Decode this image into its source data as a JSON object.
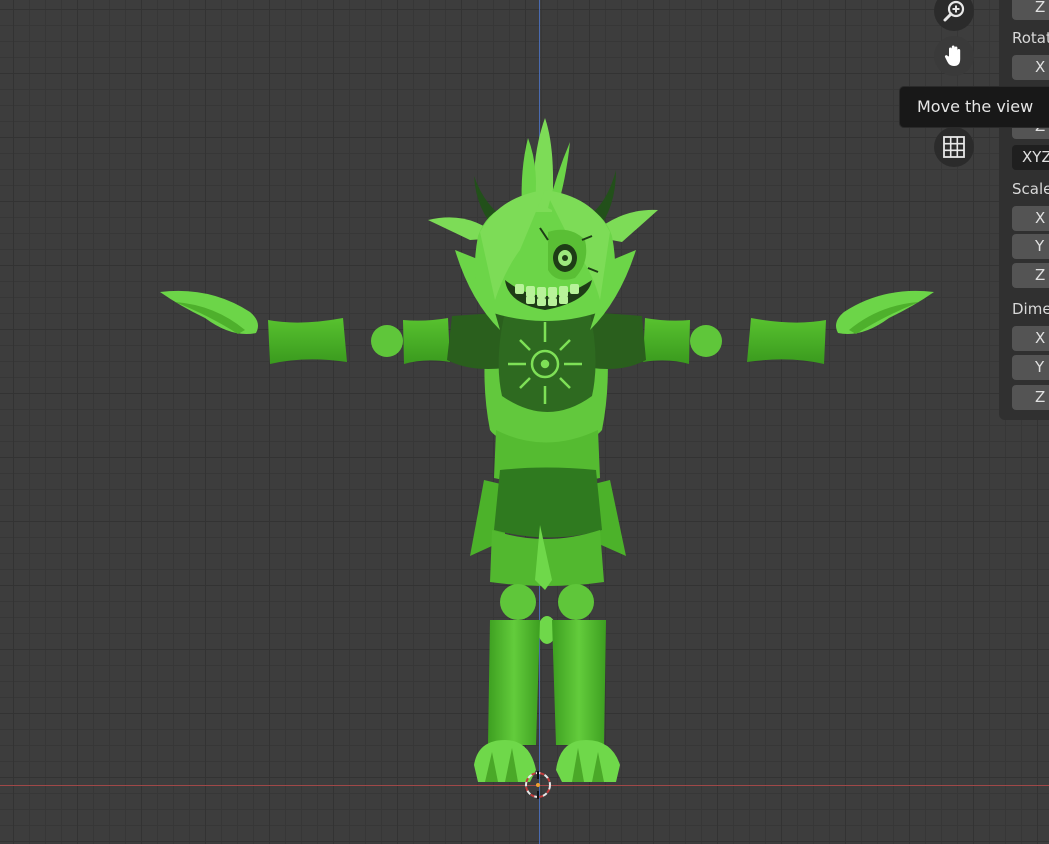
{
  "viewport": {
    "axis_colors": {
      "x": "#a04848",
      "y": "#4a6bb0"
    },
    "model_color": "#5fc63a"
  },
  "navigation": {
    "zoom_icon": "zoom-in-icon",
    "pan_icon": "hand-icon",
    "ortho_icon": "grid-icon"
  },
  "tooltip": {
    "text": "Move the view"
  },
  "properties": {
    "location_z": "Z",
    "rotation_label": "Rotat",
    "rotation_x": "X",
    "rotation_z": "Z",
    "rotation_mode": "XYZ",
    "scale_label": "Scale",
    "scale_x": "X",
    "scale_y": "Y",
    "scale_z": "Z",
    "dimensions_label": "Dime",
    "dim_x": "X",
    "dim_y": "Y",
    "dim_z": "Z"
  }
}
